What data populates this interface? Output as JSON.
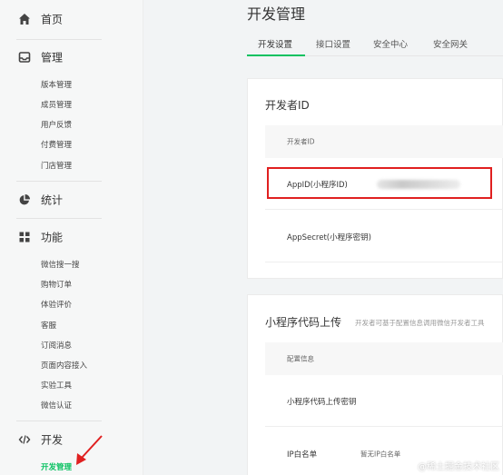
{
  "sidebar": {
    "sections": [
      {
        "label": "首页",
        "icon": "home-icon"
      },
      {
        "label": "管理",
        "icon": "inbox-icon"
      },
      {
        "label": "统计",
        "icon": "pie-chart-icon"
      },
      {
        "label": "功能",
        "icon": "grid-icon"
      },
      {
        "label": "开发",
        "icon": "code-icon"
      }
    ],
    "manage_items": [
      "版本管理",
      "成员管理",
      "用户反馈",
      "付费管理",
      "门店管理"
    ],
    "feature_items": [
      "微信搜一搜",
      "购物订单",
      "体验评价",
      "客服",
      "订阅消息",
      "页面内容接入",
      "实验工具",
      "微信认证"
    ],
    "dev_items": [
      "开发管理"
    ],
    "active_item": "开发管理",
    "accent_color": "#07c160"
  },
  "page": {
    "title": "开发管理",
    "tabs": [
      "开发设置",
      "接口设置",
      "安全中心",
      "安全网关"
    ],
    "active_tab": 0
  },
  "developer_card": {
    "title": "开发者ID",
    "table_header": "开发者ID",
    "rows": [
      {
        "label": "AppID(小程序ID)",
        "value_obscured": true
      },
      {
        "label": "AppSecret(小程序密钥)"
      }
    ]
  },
  "upload_card": {
    "title": "小程序代码上传",
    "subtitle": "开发者可基于配置信息调用微信开发者工具",
    "table_header": "配置信息",
    "rows": [
      {
        "label": "小程序代码上传密钥",
        "value": ""
      },
      {
        "label": "IP白名单",
        "value": "暂无IP白名单"
      }
    ]
  },
  "annotation": {
    "highlight_color": "#e02020"
  },
  "watermark": "@稀土掘金技术社区"
}
